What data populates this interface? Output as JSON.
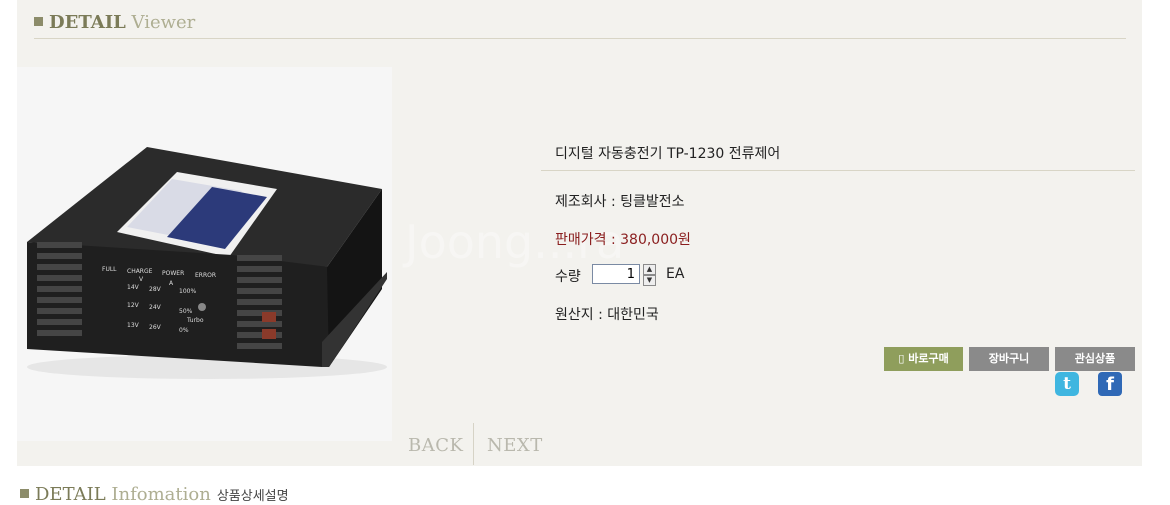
{
  "header": {
    "title_strong": "DETAIL",
    "title_light": "Viewer"
  },
  "product": {
    "name": "디지털 자동충전기 TP-1230 전류제어",
    "maker_label": "제조회사 : 팅클발전소",
    "price_label": "판매가격 : 380,000원",
    "qty_label": "수량",
    "qty_value": "1",
    "qty_unit": "EA",
    "origin_label": "원산지 : 대한민국"
  },
  "device_labels": [
    "FULL",
    "CHARGE",
    "POWER",
    "ERROR",
    "V",
    "A",
    "14V",
    "12V",
    "13V",
    "28V",
    "24V",
    "26V",
    "100%",
    "50%",
    "0%",
    "Turbo"
  ],
  "watermark": "Joong...ra",
  "buttons": {
    "buy": "바로구매",
    "cart": "장바구니",
    "wish": "관심상품"
  },
  "social": {
    "twitter": "t",
    "facebook": "f"
  },
  "nav": {
    "back": "BACK",
    "next": "NEXT"
  },
  "footer": {
    "title_strong": "DETAIL",
    "title_light": "Infomation",
    "subtitle": "상품상세설명"
  }
}
